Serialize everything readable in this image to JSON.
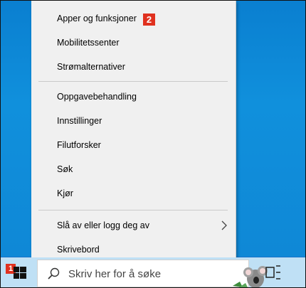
{
  "menu": {
    "items": [
      {
        "label": "Apper og funksjoner"
      },
      {
        "label": "Mobilitetssenter"
      },
      {
        "label": "Strømalternativer"
      },
      {
        "label": "Oppgavebehandling"
      },
      {
        "label": "Innstillinger"
      },
      {
        "label": "Filutforsker"
      },
      {
        "label": "Søk"
      },
      {
        "label": "Kjør"
      },
      {
        "label": "Slå av eller logg deg av"
      },
      {
        "label": "Skrivebord"
      }
    ],
    "badge": "2"
  },
  "taskbar": {
    "start_badge": "1",
    "search_placeholder": "Skriv her for å søke"
  },
  "colors": {
    "badge": "#e0311f",
    "desktop": "#0f88d6",
    "taskbar": "#bfe0f5",
    "menu": "#f0f0f0"
  },
  "icons": [
    "windows-logo-icon",
    "search-icon",
    "task-view-icon",
    "chevron-right-icon"
  ]
}
